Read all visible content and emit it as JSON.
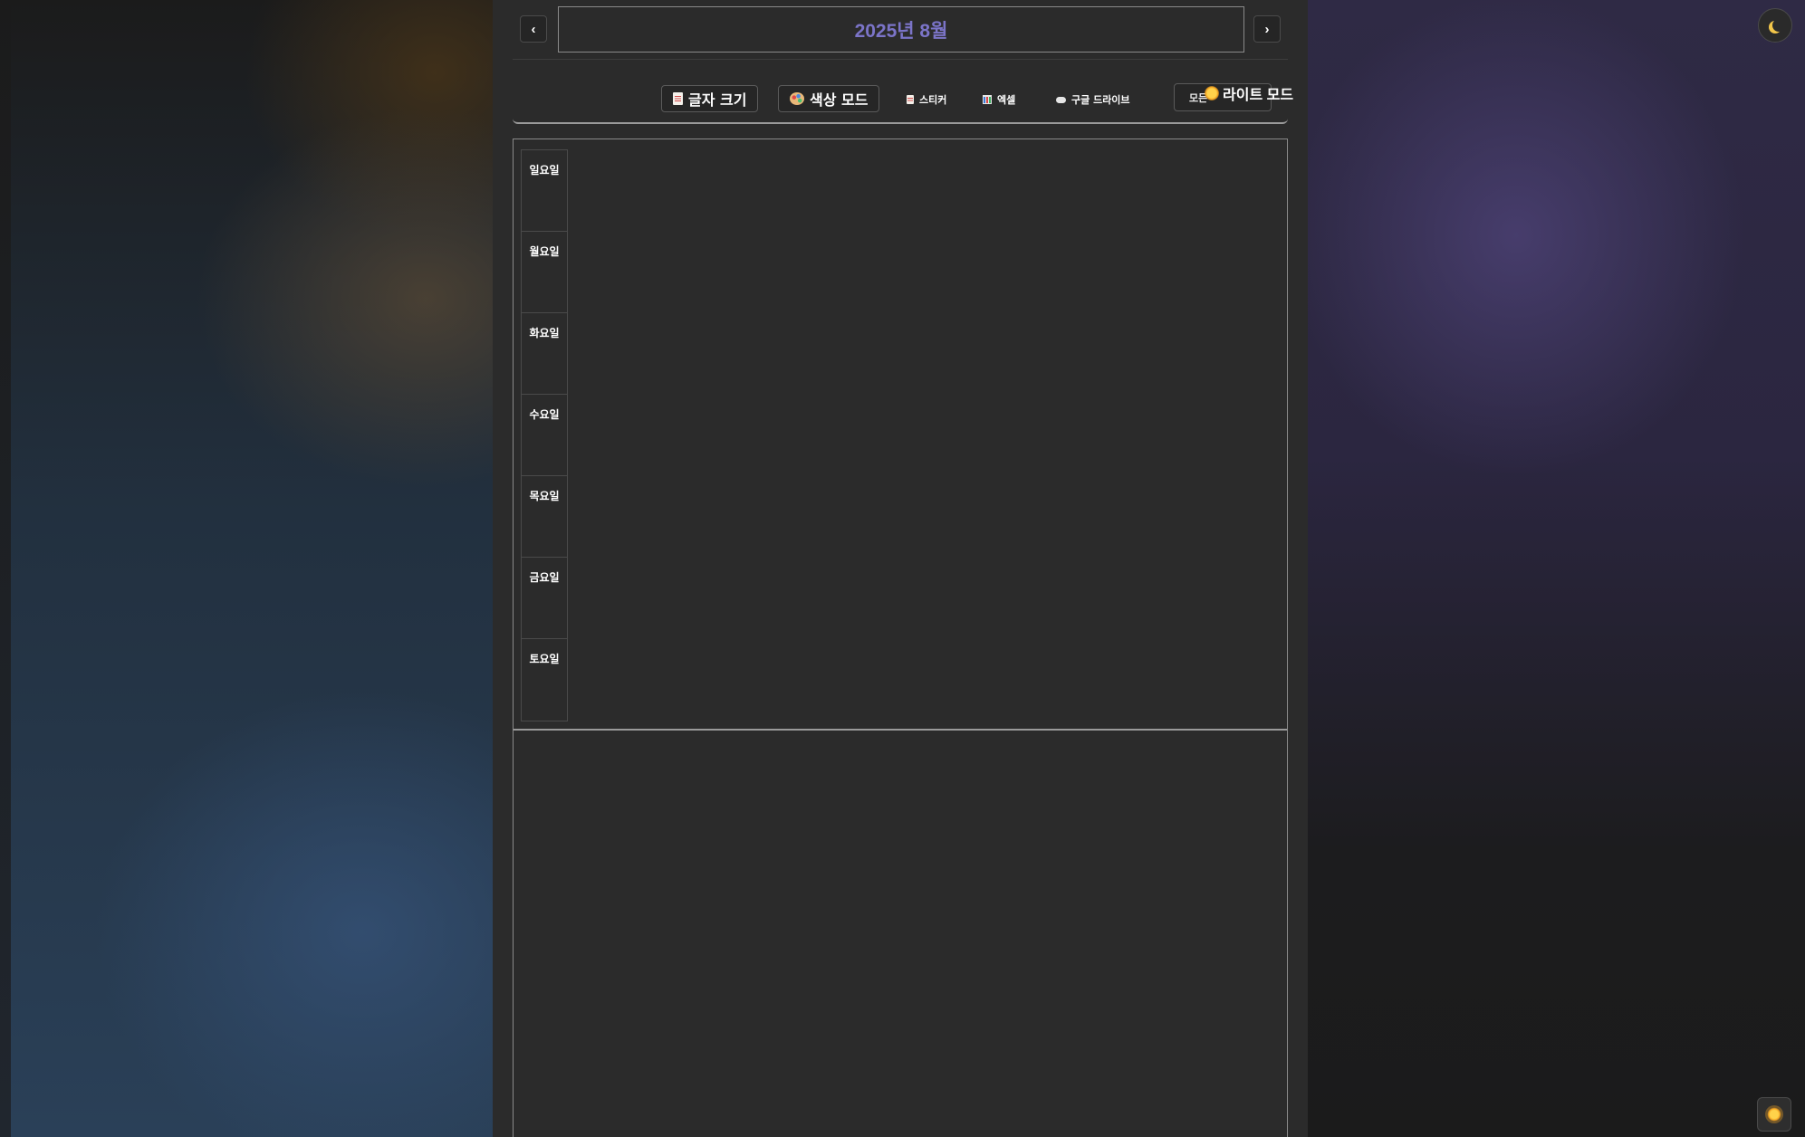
{
  "header": {
    "prev_label": "‹",
    "next_label": "›",
    "month_title": "2025년 8월"
  },
  "toolbar": {
    "font_size_label": "글자 크기",
    "color_mode_label": "색상 모드",
    "sticker_label": "스티커",
    "excel_label": "엑셀",
    "google_drive_label": "구글 드라이브",
    "all_label_partial": "모든",
    "light_mode_label": "라이트 모드"
  },
  "calendar": {
    "weekdays": [
      "일요일",
      "월요일",
      "화요일",
      "수요일",
      "목요일",
      "금요일",
      "토요일"
    ]
  },
  "icons": {
    "font_size": "document-icon",
    "color_mode": "palette-icon",
    "sticker": "document-icon",
    "excel": "bar-chart-icon",
    "google_drive": "cloud-icon",
    "light_mode": "sun-icon",
    "theme_toggle_top": "moon-icon",
    "theme_toggle_bottom": "sun-icon"
  },
  "colors": {
    "accent": "#7b74c8",
    "panel_bg": "#2b2b2b"
  }
}
